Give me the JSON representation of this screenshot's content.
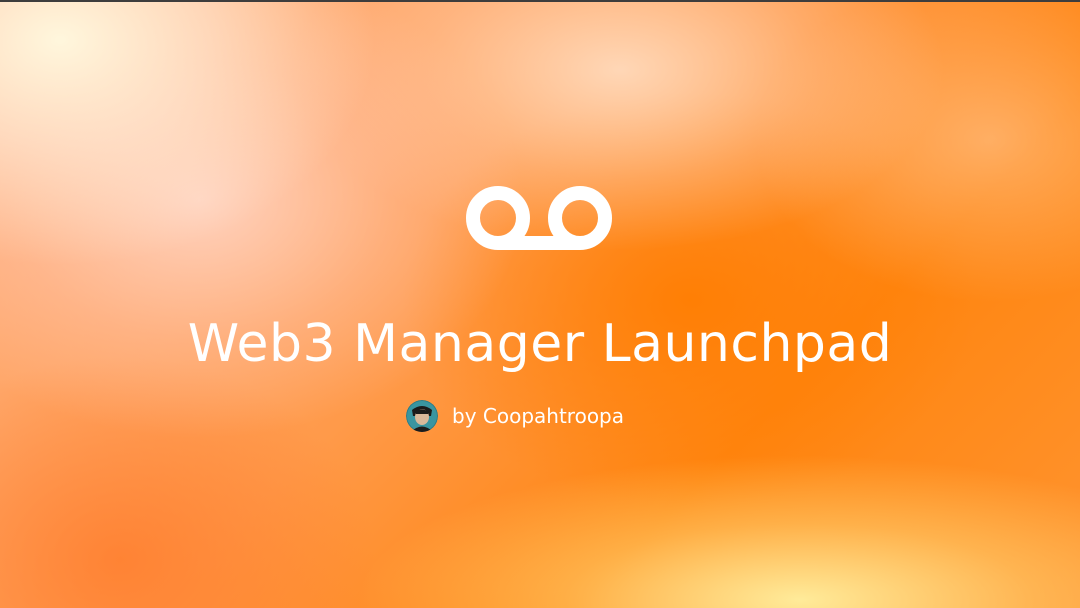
{
  "page": {
    "title": "Web3 Manager Launchpad",
    "author_byline": "by Coopahtroopa",
    "logo_icon": "voicemail-loop-logo-icon",
    "avatar_icon": "author-avatar",
    "colors": {
      "background_primary": "#ff8510",
      "background_highlight": "#fff5d0",
      "text": "#ffffff"
    }
  }
}
